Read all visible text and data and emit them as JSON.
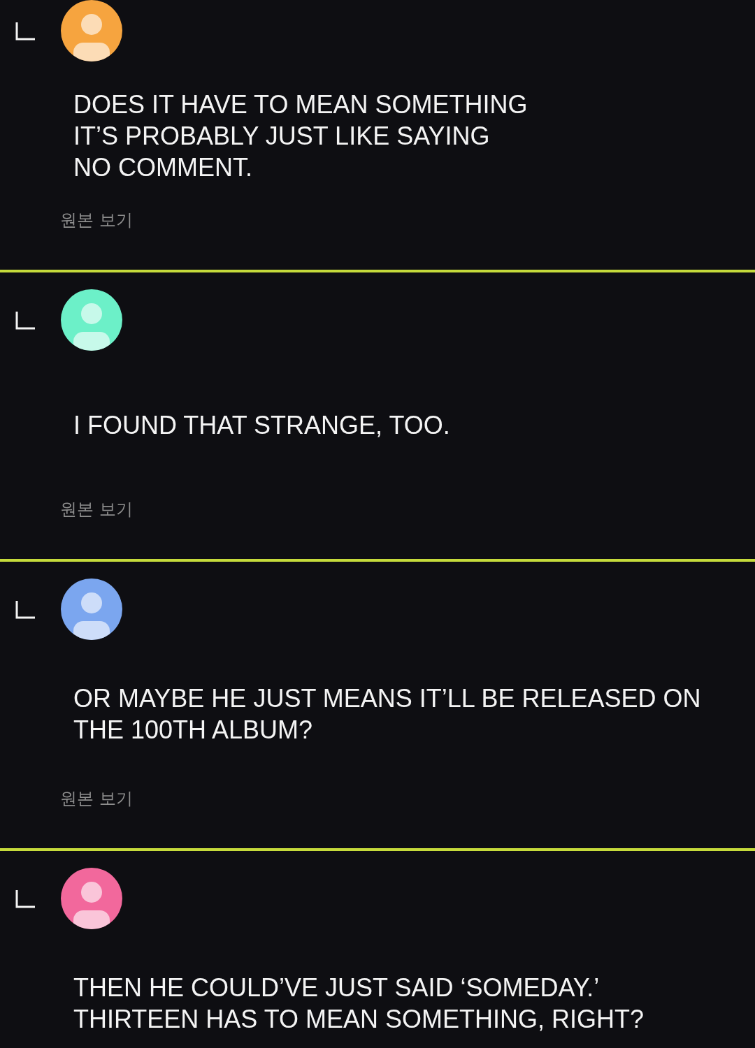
{
  "comments": [
    {
      "color": "#f6a43f",
      "text": "DOES IT HAVE TO MEAN SOMETHING\nIT’S PROBABLY JUST LIKE SAYING\nNO COMMENT.",
      "link": "원본 보기"
    },
    {
      "color": "#6cf0c8",
      "text": "I FOUND THAT STRANGE, TOO.",
      "link": "원본 보기"
    },
    {
      "color": "#7ba6ef",
      "text": "OR MAYBE HE JUST MEANS IT’LL BE RELEASED ON THE 100TH ALBUM?",
      "link": "원본 보기"
    },
    {
      "color": "#f2689c",
      "text": "THEN HE COULD’VE JUST SAID ‘SOMEDAY.’\nTHIRTEEN HAS TO MEAN SOMETHING, RIGHT?"
    }
  ]
}
